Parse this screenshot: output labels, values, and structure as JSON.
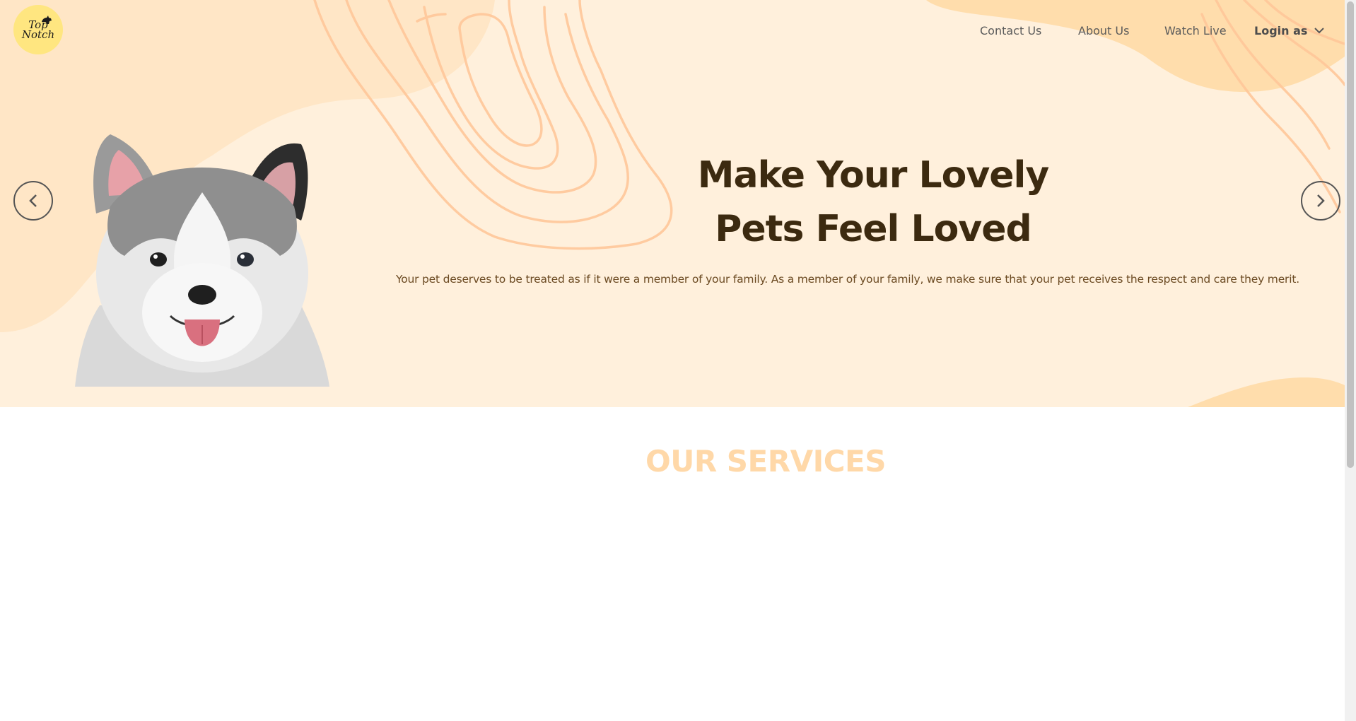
{
  "logo": {
    "line1": "Top",
    "line2": "Notch"
  },
  "nav": {
    "contact": "Contact Us",
    "about": "About Us",
    "watch": "Watch Live",
    "login": "Login as"
  },
  "hero": {
    "title_line1": "Make Your Lovely",
    "title_line2": "Pets Feel Loved",
    "subtitle": "Your pet deserves to be treated as if it were a member of your family. As a member of your family, we make sure that your pet receives the respect and care they merit."
  },
  "services": {
    "title": "OUR SERVICES"
  },
  "icons": {
    "prev": "chevron-left-icon",
    "next": "chevron-right-icon",
    "dropdown": "chevron-down-icon"
  },
  "colors": {
    "hero_bg": "#fff0dc",
    "blob": "#ffd9a3",
    "contour": "#ffc79a",
    "title": "#3c2a10",
    "services_title": "#ffd8a8",
    "logo_bg": "#ffe680"
  }
}
